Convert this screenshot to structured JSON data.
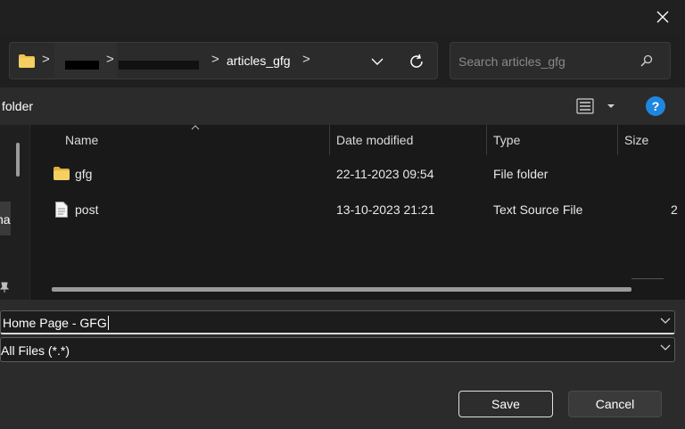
{
  "title_bar": {
    "close_icon": "close-icon"
  },
  "address_bar": {
    "crumbs": [
      "articles_gfg"
    ],
    "separators": [
      ">",
      ">",
      ">",
      ">"
    ],
    "folder_icon": "folder-icon"
  },
  "search": {
    "placeholder": "Search articles_gfg"
  },
  "command_bar": {
    "label": "folder"
  },
  "nav_pane": {
    "partial_text": "na"
  },
  "columns": {
    "name": "Name",
    "date_modified": "Date modified",
    "type": "Type",
    "size": "Size"
  },
  "files": [
    {
      "name": "gfg",
      "date": "22-11-2023 09:54",
      "type": "File folder",
      "size": "",
      "icon": "folder-icon"
    },
    {
      "name": "post",
      "date": "13-10-2023 21:21",
      "type": "Text Source File",
      "size": "2",
      "icon": "text-file-icon"
    }
  ],
  "file_name": {
    "value": "Home Page - GFG"
  },
  "file_type": {
    "value": "All Files (*.*)"
  },
  "buttons": {
    "save": "Save",
    "cancel": "Cancel"
  },
  "colors": {
    "accent": "#1f86e0",
    "folder": "#f2c14e"
  }
}
